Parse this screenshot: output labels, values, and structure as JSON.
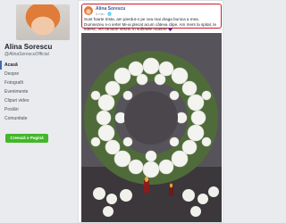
{
  "profile": {
    "name": "Alina Sorescu",
    "handle": "@AlinaSorescuOfficial"
  },
  "nav": {
    "items": [
      {
        "label": "Acasă",
        "active": true
      },
      {
        "label": "Despre",
        "active": false
      },
      {
        "label": "Fotografii",
        "active": false
      },
      {
        "label": "Evenimente",
        "active": false
      },
      {
        "label": "Clipuri video",
        "active": false
      },
      {
        "label": "Postări",
        "active": false
      },
      {
        "label": "Comunitate",
        "active": false
      }
    ],
    "promote_label": "Creează o Pagină"
  },
  "post": {
    "author": "Alina Sorescu",
    "time": "5 min · 🌐",
    "text": "Sunt foarte trista, am pierdut-o pe cea mai draga bunica a mea. Dumnezeu s-o ierte! Mi-ai plecat acum câteva clipe. Am mers la spital, te iubesc, vei ramane vesnic in sufletele noastre",
    "heart_color": "#5b2b8c"
  },
  "colors": {
    "accent": "#4267b2",
    "highlight_border": "#d0192b",
    "promote_button": "#42b72a"
  }
}
